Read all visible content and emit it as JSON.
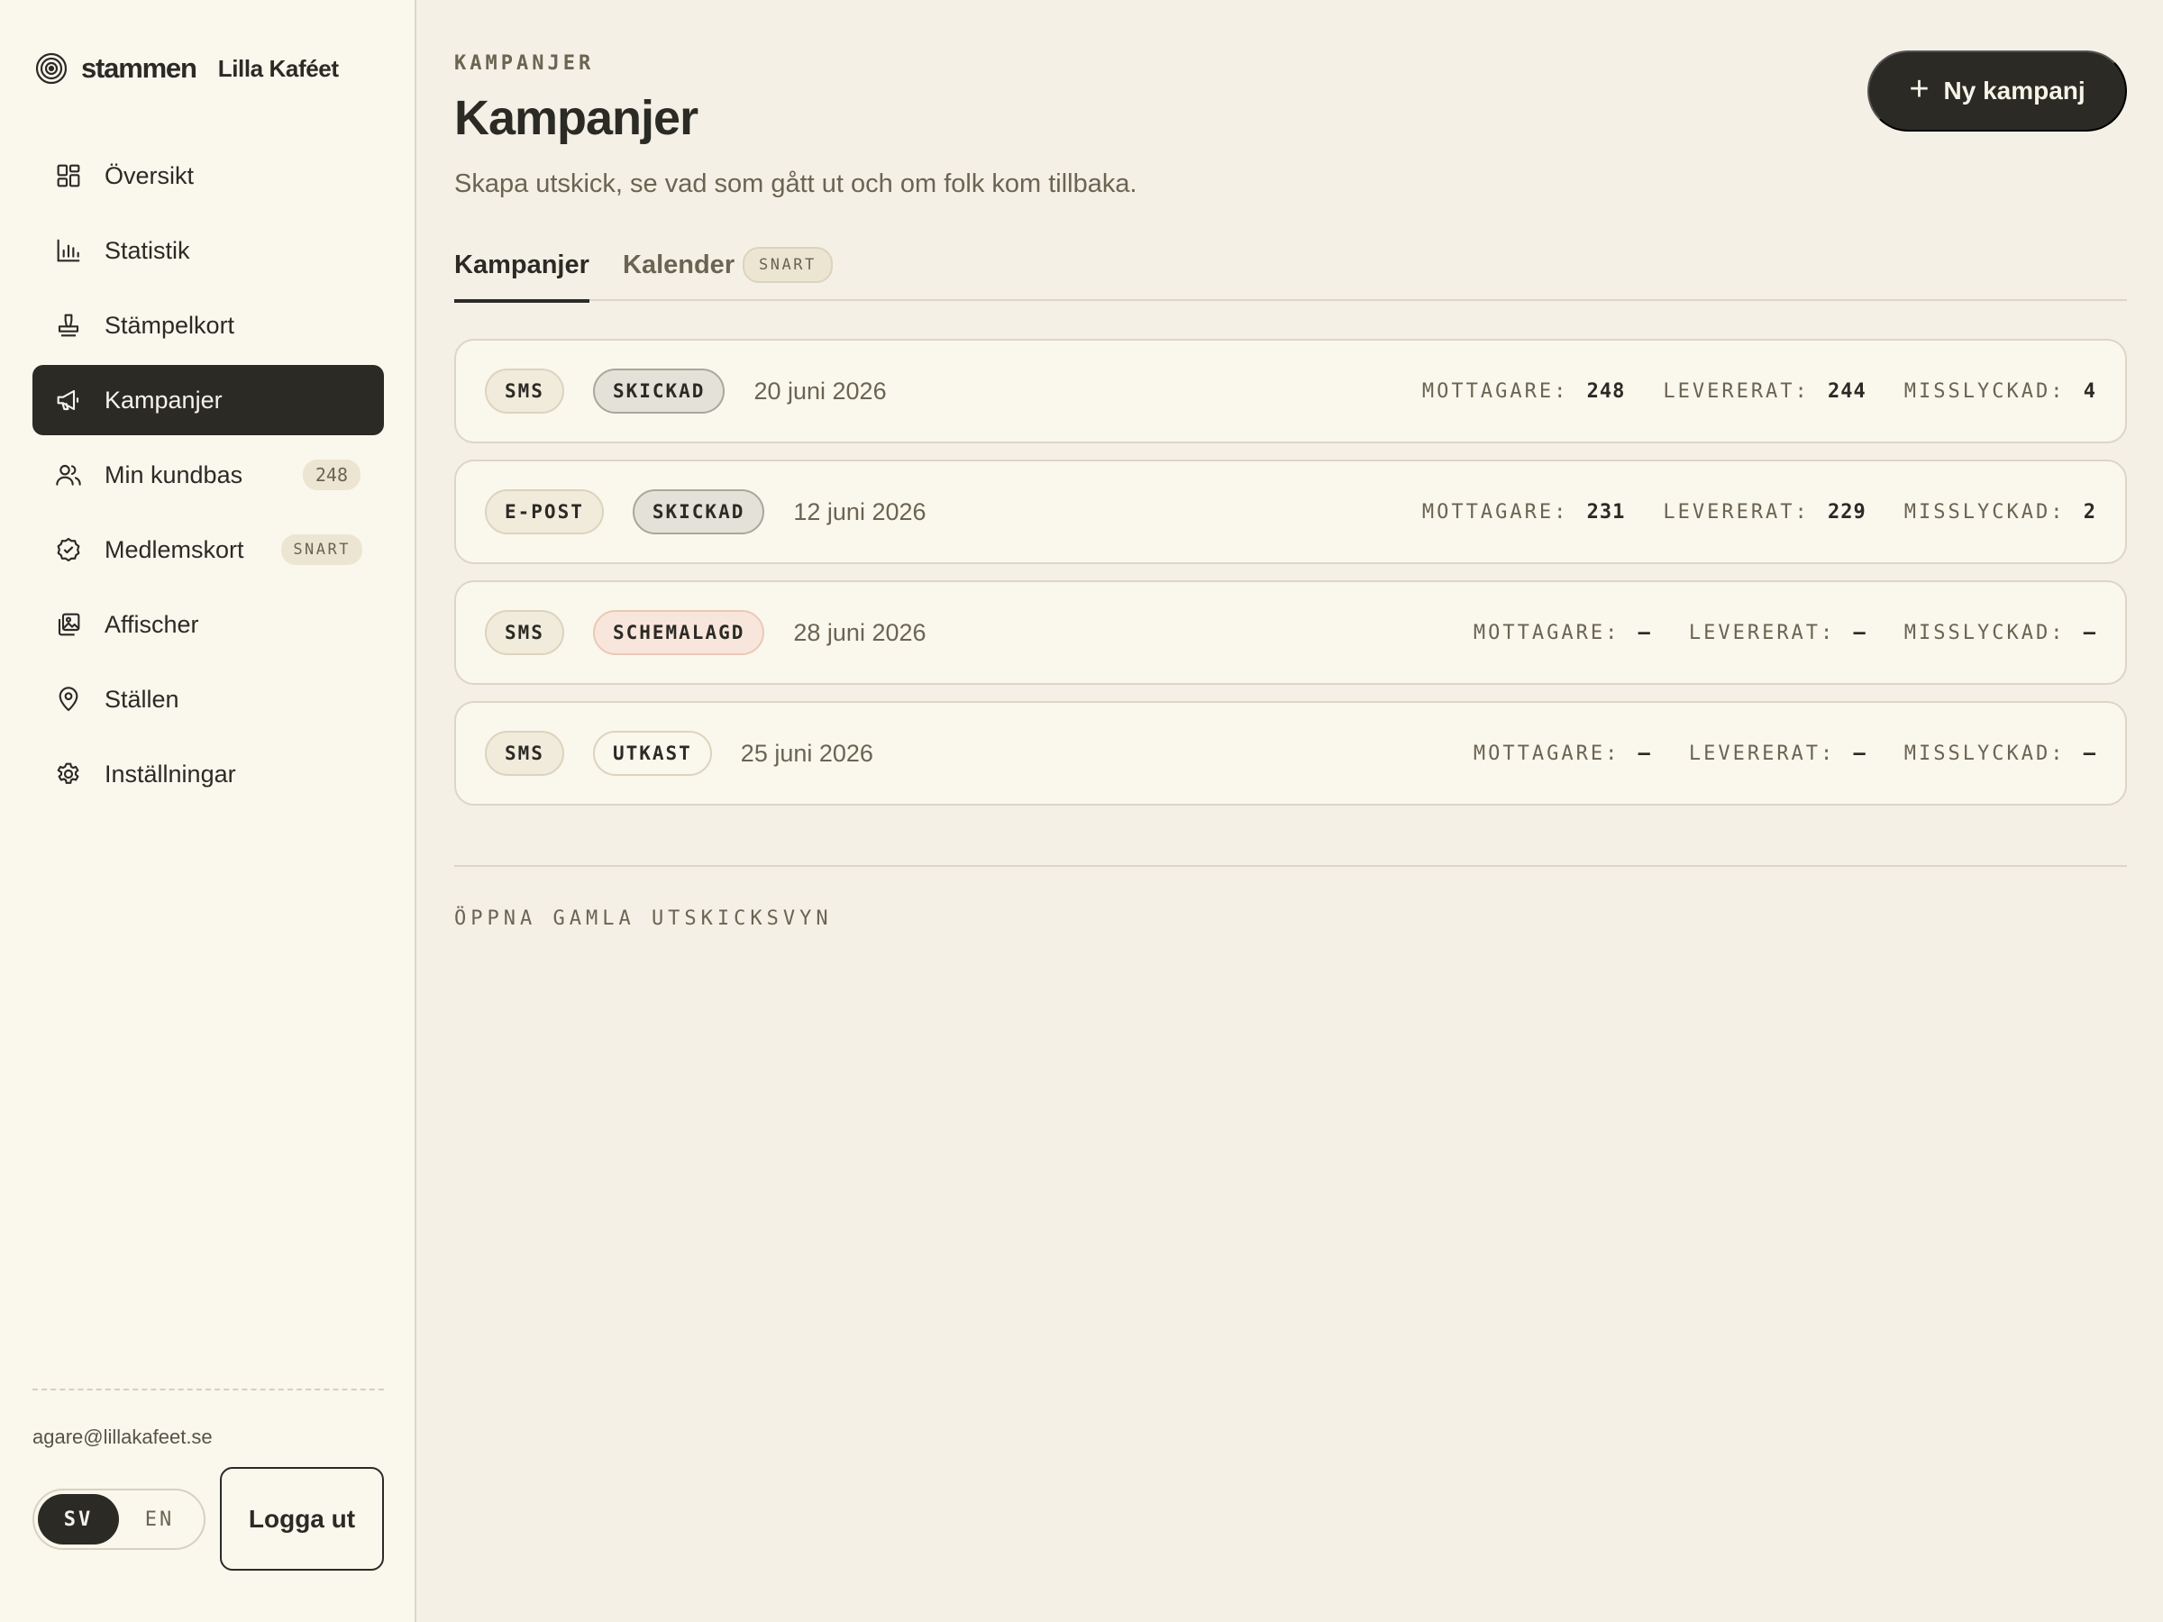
{
  "brand": {
    "name": "stammen",
    "cafe": "Lilla Kaféet"
  },
  "sidebar": {
    "items": [
      {
        "label": "Översikt",
        "icon": "grid-icon"
      },
      {
        "label": "Statistik",
        "icon": "bar-chart-icon"
      },
      {
        "label": "Stämpelkort",
        "icon": "stamp-icon"
      },
      {
        "label": "Kampanjer",
        "icon": "megaphone-icon",
        "active": true
      },
      {
        "label": "Min kundbas",
        "icon": "users-icon",
        "badge": "248"
      },
      {
        "label": "Medlemskort",
        "icon": "badge-check-icon",
        "soon": "SNART"
      },
      {
        "label": "Affischer",
        "icon": "images-icon"
      },
      {
        "label": "Ställen",
        "icon": "map-pin-icon"
      },
      {
        "label": "Inställningar",
        "icon": "gear-icon"
      }
    ],
    "user_email": "agare@lillakafeet.se",
    "lang": {
      "sv": "SV",
      "en": "EN",
      "active": "SV"
    },
    "logout_label": "Logga ut"
  },
  "header": {
    "eyebrow": "KAMPANJER",
    "title": "Kampanjer",
    "subtitle": "Skapa utskick, se vad som gått ut och om folk kom tillbaka.",
    "new_button": "Ny kampanj"
  },
  "tabs": [
    {
      "label": "Kampanjer",
      "active": true
    },
    {
      "label": "Kalender",
      "soon": "SNART"
    }
  ],
  "stat_labels": {
    "recipients": "MOTTAGARE:",
    "delivered": "LEVERERAT:",
    "failed": "MISSLYCKAD:"
  },
  "campaigns": [
    {
      "channel": "SMS",
      "status": "SKICKAD",
      "date": "20 juni 2026",
      "recipients": "248",
      "delivered": "244",
      "failed": "4"
    },
    {
      "channel": "E-POST",
      "status": "SKICKAD",
      "date": "12 juni 2026",
      "recipients": "231",
      "delivered": "229",
      "failed": "2"
    },
    {
      "channel": "SMS",
      "status": "SCHEMALAGD",
      "date": "28 juni 2026",
      "recipients": "–",
      "delivered": "–",
      "failed": "–"
    },
    {
      "channel": "SMS",
      "status": "UTKAST",
      "date": "25 juni 2026",
      "recipients": "–",
      "delivered": "–",
      "failed": "–"
    }
  ],
  "old_view_link": "ÖPPNA GAMLA UTSKICKSVYN",
  "colors": {
    "ink": "#2b2a25",
    "background": "#f4f0e6",
    "sidebar": "#faf7ed",
    "scheduled": "#f8e6dc"
  }
}
